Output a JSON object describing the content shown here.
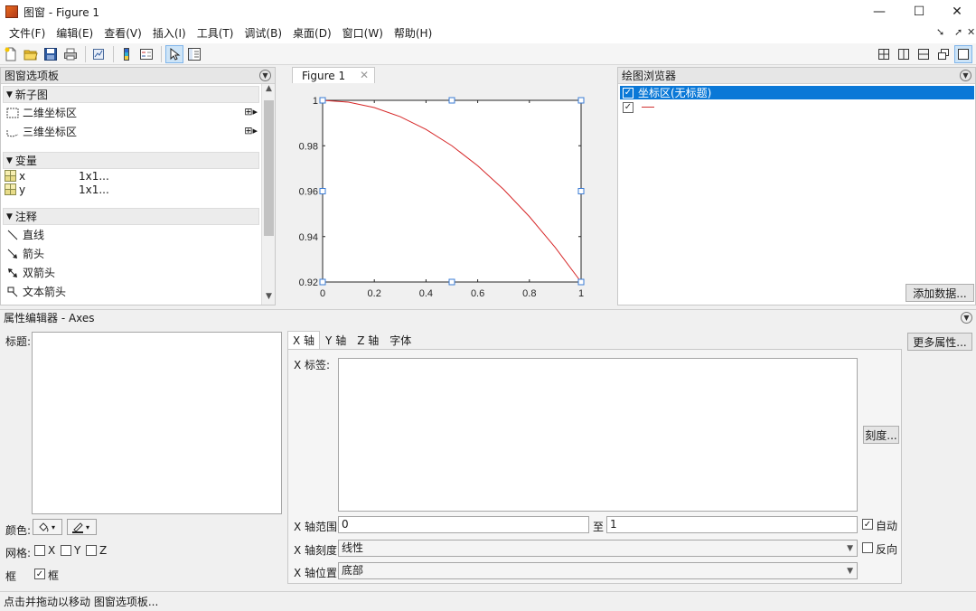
{
  "window": {
    "title": "图窗 - Figure 1",
    "minimize": "—",
    "maximize": "☐",
    "close": "✕"
  },
  "menu": {
    "items": [
      "文件(F)",
      "编辑(E)",
      "查看(V)",
      "插入(I)",
      "工具(T)",
      "调试(B)",
      "桌面(D)",
      "窗口(W)",
      "帮助(H)"
    ]
  },
  "palette": {
    "header": "图窗选项板",
    "sections": {
      "subplots": "新子图",
      "variables": "变量",
      "annotations": "注释"
    },
    "subplot_items": [
      "二维坐标区",
      "三维坐标区"
    ],
    "variables": [
      {
        "name": "x",
        "size": "1x1..."
      },
      {
        "name": "y",
        "size": "1x1..."
      }
    ],
    "annotation_items": [
      "直线",
      "箭头",
      "双箭头",
      "文本箭头"
    ]
  },
  "figure": {
    "tab_label": "Figure 1",
    "tab_close": "✕"
  },
  "chart_data": {
    "type": "line",
    "title": "",
    "xlabel": "",
    "ylabel": "",
    "xlim": [
      0,
      1
    ],
    "ylim": [
      0.92,
      1
    ],
    "xticks": [
      "0",
      "0.2",
      "0.4",
      "0.6",
      "0.8",
      "1"
    ],
    "yticks": [
      "0.92",
      "0.94",
      "0.96",
      "0.98",
      "1"
    ],
    "series": [
      {
        "color": "#d62728",
        "x": [
          0,
          0.1,
          0.2,
          0.3,
          0.4,
          0.5,
          0.6,
          0.7,
          0.8,
          0.9,
          1.0
        ],
        "y": [
          1.0,
          0.9992,
          0.9968,
          0.9928,
          0.9872,
          0.98,
          0.9712,
          0.9608,
          0.9488,
          0.9352,
          0.92
        ]
      }
    ],
    "grid": false
  },
  "browser": {
    "header": "绘图浏览器",
    "items": [
      {
        "label": "坐标区(无标题)",
        "checked": "✓"
      },
      {
        "label": "",
        "checked": "✓"
      }
    ],
    "add_data": "添加数据..."
  },
  "props": {
    "header": "属性编辑器 - Axes",
    "title_label": "标题:",
    "color_label": "颜色:",
    "grid_label": "网格:",
    "grid_x": "X",
    "grid_y": "Y",
    "grid_z": "Z",
    "box_label": "框",
    "box_check_label": "框",
    "box_checked": "✓",
    "more_props": "更多属性...",
    "tabs": [
      "X 轴",
      "Y 轴",
      "Z 轴",
      "字体"
    ],
    "x_label_label": "X 标签:",
    "ticks_button": "刻度...",
    "x_range_label": "X 轴范围:",
    "x_min": "0",
    "to_label": "至",
    "x_max": "1",
    "auto_label": "自动",
    "auto_checked": "✓",
    "x_scale_label": "X 轴刻度:",
    "x_scale_value": "线性",
    "reverse_label": "反向",
    "x_loc_label": "X 轴位置:",
    "x_loc_value": "底部"
  },
  "status": {
    "text": "点击并拖动以移动 图窗选项板..."
  }
}
